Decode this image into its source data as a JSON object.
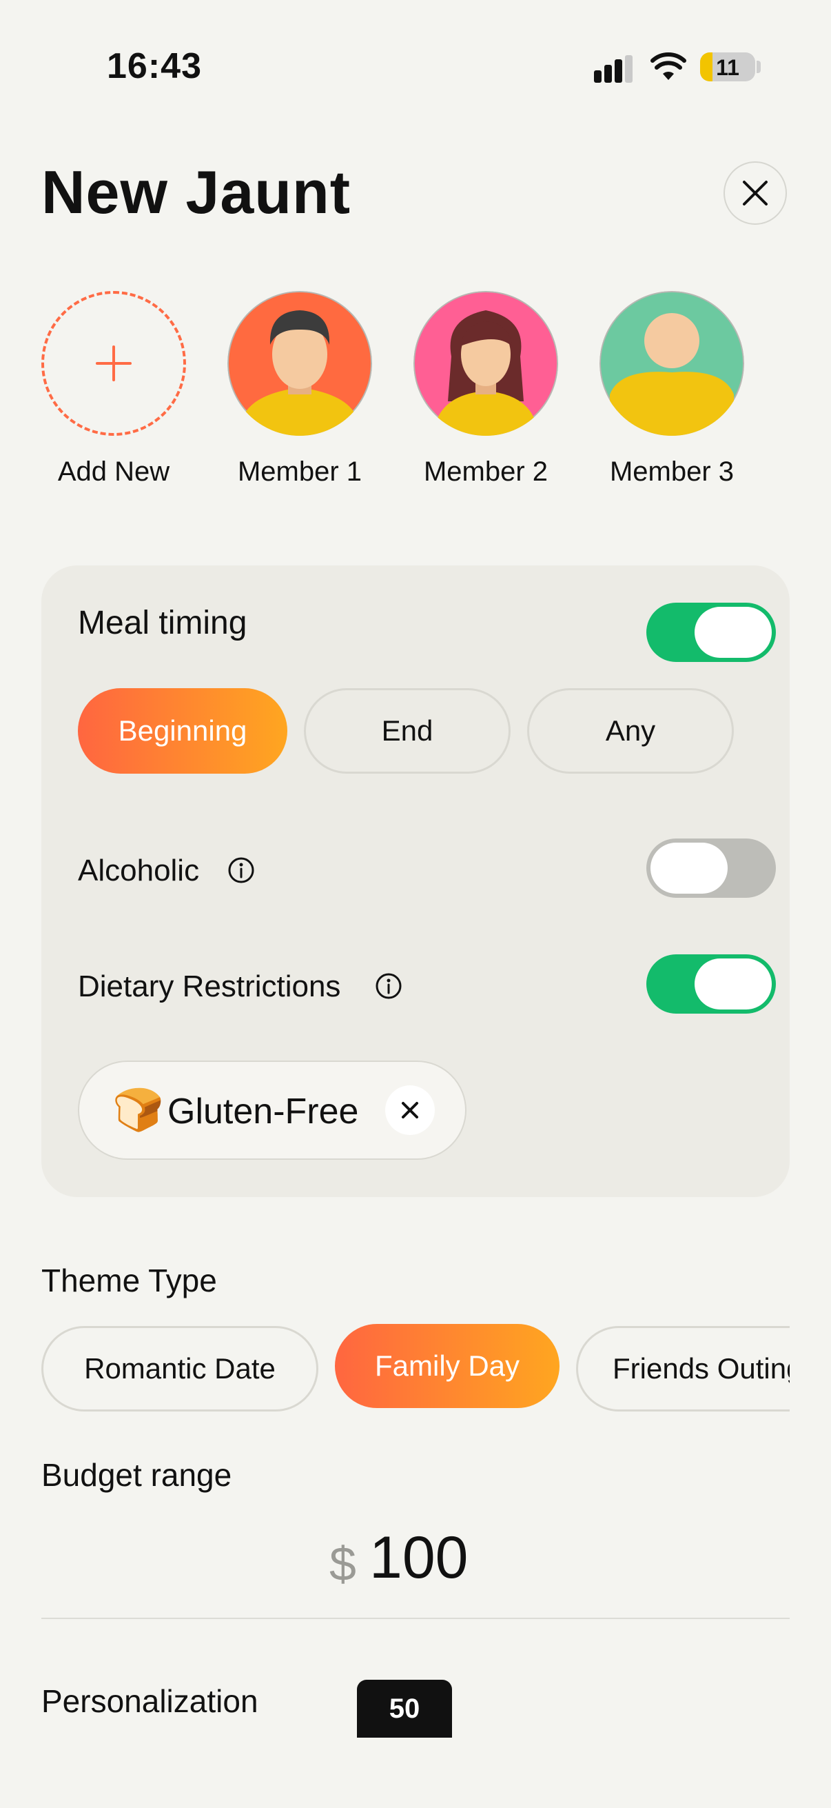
{
  "status_bar": {
    "time": "16:43",
    "battery": "11"
  },
  "header": {
    "title": "New Jaunt"
  },
  "members": {
    "add_label": "Add New",
    "items": [
      {
        "label": "Member 1"
      },
      {
        "label": "Member 2"
      },
      {
        "label": "Member 3"
      }
    ]
  },
  "meal_timing": {
    "label": "Meal timing",
    "enabled": true,
    "options": [
      "Beginning",
      "End",
      "Any"
    ],
    "selected": "Beginning"
  },
  "alcoholic": {
    "label": "Alcoholic",
    "enabled": false
  },
  "dietary": {
    "label": "Dietary Restrictions",
    "enabled": true,
    "chips": [
      {
        "emoji": "🍞",
        "label": "Gluten-Free"
      }
    ]
  },
  "theme": {
    "label": "Theme Type",
    "options": [
      "Romantic Date",
      "Family Day",
      "Friends Outing"
    ],
    "selected": "Family Day"
  },
  "budget": {
    "label": "Budget range",
    "currency": "$",
    "value": "100"
  },
  "personalization": {
    "label": "Personalization",
    "value": "50"
  },
  "colors": {
    "accent_start": "#ff6640",
    "accent_end": "#ffa620",
    "toggle_on": "#13bb6b",
    "dashed": "#ff6b45"
  }
}
